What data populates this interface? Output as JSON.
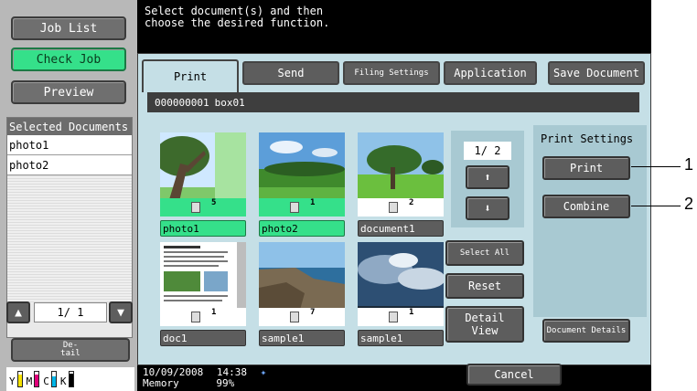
{
  "left_panel": {
    "job_list": "Job List",
    "check_job": "Check Job",
    "preview": "Preview",
    "selected_header": "Selected Documents",
    "selected_items": [
      "photo1",
      "photo2"
    ],
    "page_indicator": "1/  1",
    "detail_label": "De-\ntail",
    "toner": [
      "Y",
      "M",
      "C",
      "K"
    ]
  },
  "message": {
    "line1": "Select document(s) and then",
    "line2": "choose the desired function."
  },
  "tabs": {
    "print": "Print",
    "send": "Send",
    "filing_settings": "Filing Settings",
    "application": "Application",
    "save_document": "Save Document"
  },
  "box": {
    "number": "000000001",
    "name": "box01"
  },
  "thumbnails": [
    {
      "name": "photo1",
      "pages": "5",
      "selected": true
    },
    {
      "name": "photo2",
      "pages": "1",
      "selected": true
    },
    {
      "name": "document1",
      "pages": "2",
      "selected": false
    },
    {
      "name": "doc1",
      "pages": "1",
      "selected": false
    },
    {
      "name": "sample1",
      "pages": "7",
      "selected": false
    },
    {
      "name": "sample1",
      "pages": "1",
      "selected": false
    }
  ],
  "paging": {
    "indicator": "1/  2",
    "up_icon": "arrow-up-icon",
    "down_icon": "arrow-down-icon"
  },
  "actions": {
    "select_all": "Select All",
    "reset": "Reset",
    "detail_view": "Detail View"
  },
  "print_settings": {
    "title": "Print Settings",
    "print": "Print",
    "combine": "Combine",
    "document_details": "Document Details"
  },
  "cancel": "Cancel",
  "status": {
    "date": "10/09/2008",
    "time": "14:38",
    "memory_label": "Memory",
    "memory_value": "99%"
  },
  "callouts": [
    "1",
    "2"
  ]
}
